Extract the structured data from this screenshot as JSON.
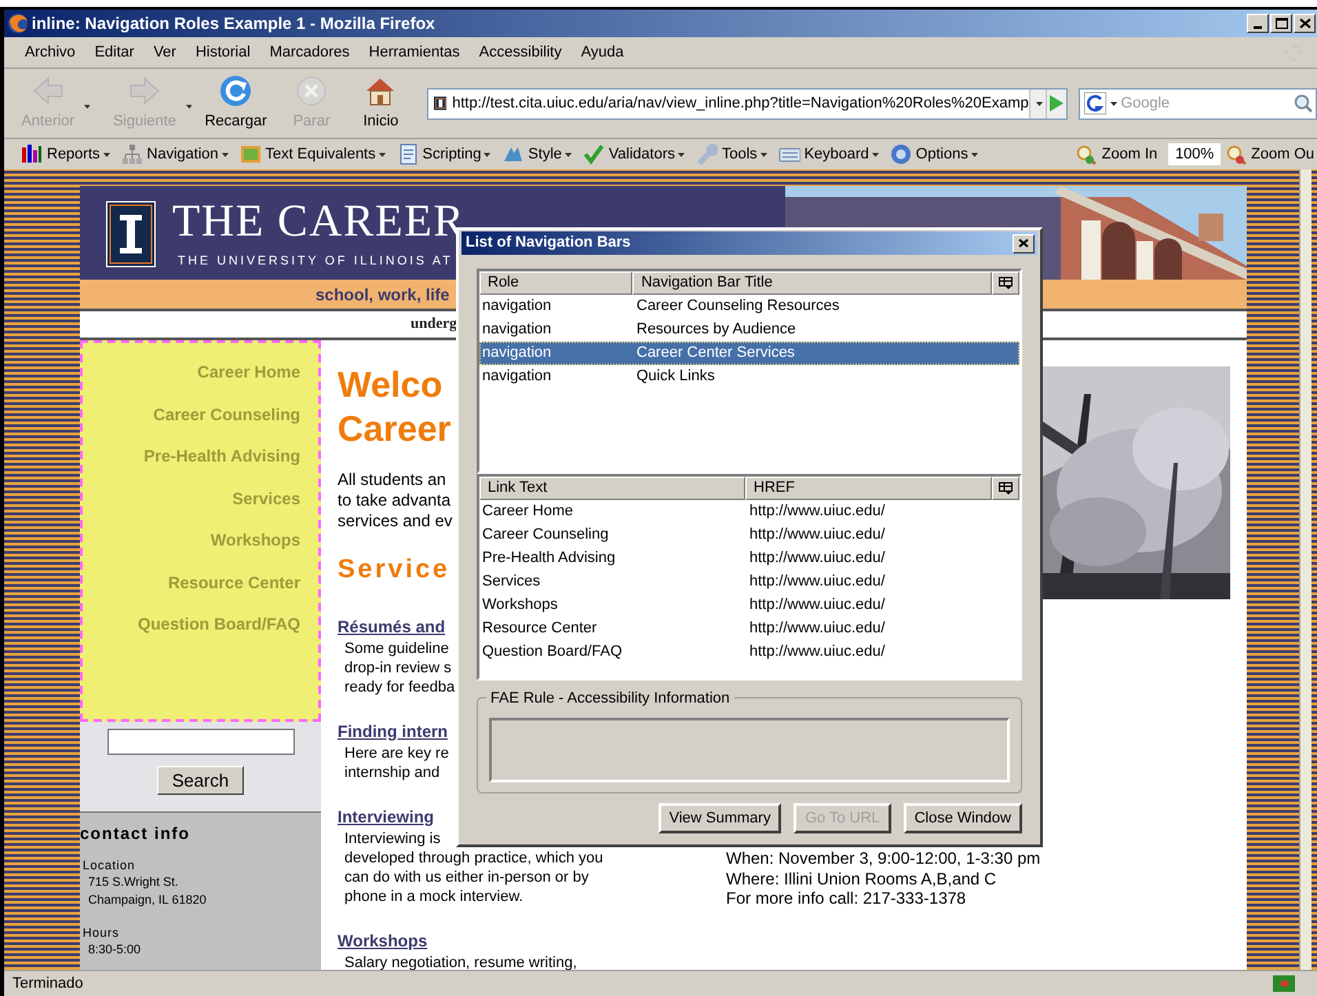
{
  "window": {
    "title": "inline: Navigation Roles Example 1 - Mozilla Firefox"
  },
  "menu": [
    "Archivo",
    "Editar",
    "Ver",
    "Historial",
    "Marcadores",
    "Herramientas",
    "Accessibility",
    "Ayuda"
  ],
  "nav_buttons": [
    {
      "label": "Anterior",
      "kind": "back",
      "disabled": true
    },
    {
      "label": "Siguiente",
      "kind": "forward",
      "disabled": true
    },
    {
      "label": "Recargar",
      "kind": "reload",
      "disabled": false
    },
    {
      "label": "Parar",
      "kind": "stop",
      "disabled": true
    },
    {
      "label": "Inicio",
      "kind": "home",
      "disabled": false
    }
  ],
  "address": {
    "value": "http://test.cita.uiuc.edu/aria/nav/view_inline.php?title=Navigation%20Roles%20Examp"
  },
  "search": {
    "placeholder": "Google"
  },
  "toolbar": [
    {
      "label": "Reports",
      "kind": "reports"
    },
    {
      "label": "Navigation",
      "kind": "navigation"
    },
    {
      "label": "Text Equivalents",
      "kind": "text"
    },
    {
      "label": "Scripting",
      "kind": "scripting"
    },
    {
      "label": "Style",
      "kind": "style"
    },
    {
      "label": "Validators",
      "kind": "validators"
    },
    {
      "label": "Tools",
      "kind": "tools"
    },
    {
      "label": "Keyboard",
      "kind": "keyboard"
    },
    {
      "label": "Options",
      "kind": "options"
    }
  ],
  "zoom": {
    "zoom_in": "Zoom In",
    "value": "100%",
    "zoom_out": "Zoom Ou"
  },
  "page": {
    "header": {
      "title": "THE CAREER",
      "subtitle": "THE UNIVERSITY OF ILLINOIS AT",
      "tagline": "school, work, life",
      "subnav": "underg"
    },
    "nav_links": [
      "Career Home",
      "Career Counseling",
      "Pre-Health Advising",
      "Services",
      "Workshops",
      "Resource Center",
      "Question Board/FAQ"
    ],
    "search_button": "Search",
    "contact": {
      "title": "contact info",
      "items": [
        {
          "label": "Location",
          "lines": [
            "715 S.Wright St.",
            "Champaign, IL 61820"
          ]
        },
        {
          "label": "Hours",
          "lines": [
            "8:30-5:00"
          ]
        }
      ]
    },
    "welcome": [
      "Welco",
      "Career"
    ],
    "intro": [
      "All students an",
      "to take advanta",
      "services and ev"
    ],
    "services_heading": "Service",
    "sections": [
      {
        "heading": "Résumés and",
        "text": [
          "Some guideline",
          "drop-in review s",
          "ready for feedba"
        ]
      },
      {
        "heading": "Finding intern",
        "text": [
          "Here are key re",
          "internship and"
        ]
      },
      {
        "heading": "Interviewing",
        "text": [
          "Interviewing is",
          "developed through practice, which you",
          "can do with us either in-person or by",
          "phone in a mock interview."
        ]
      },
      {
        "heading": "Workshops",
        "text": [
          "Salary negotiation, resume writing,"
        ]
      }
    ],
    "event": [
      "When: November 3, 9:00-12:00, 1-3:30 pm",
      "Where: Illini Union Rooms A,B,and C",
      "For more info call: 217-333-1378"
    ]
  },
  "dialog": {
    "title": "List of Navigation Bars",
    "bars": {
      "columns": [
        "Role",
        "Navigation Bar Title"
      ],
      "rows": [
        {
          "role": "navigation",
          "title": "Career Counseling Resources",
          "selected": false
        },
        {
          "role": "navigation",
          "title": "Resources by Audience",
          "selected": false
        },
        {
          "role": "navigation",
          "title": "Career Center Services",
          "selected": true
        },
        {
          "role": "navigation",
          "title": "Quick Links",
          "selected": false
        }
      ]
    },
    "links": {
      "columns": [
        "Link Text",
        "HREF"
      ],
      "rows": [
        {
          "text": "Career Home",
          "href": "http://www.uiuc.edu/"
        },
        {
          "text": "Career Counseling",
          "href": "http://www.uiuc.edu/"
        },
        {
          "text": "Pre-Health Advising",
          "href": "http://www.uiuc.edu/"
        },
        {
          "text": "Services",
          "href": "http://www.uiuc.edu/"
        },
        {
          "text": "Workshops",
          "href": "http://www.uiuc.edu/"
        },
        {
          "text": "Resource Center",
          "href": "http://www.uiuc.edu/"
        },
        {
          "text": "Question Board/FAQ",
          "href": "http://www.uiuc.edu/"
        }
      ]
    },
    "group_title": "FAE Rule - Accessibility Information",
    "buttons": [
      {
        "label": "View Summary",
        "disabled": false
      },
      {
        "label": "Go To URL",
        "disabled": true
      },
      {
        "label": "Close Window",
        "disabled": false
      }
    ]
  },
  "status_bar": "Terminado"
}
